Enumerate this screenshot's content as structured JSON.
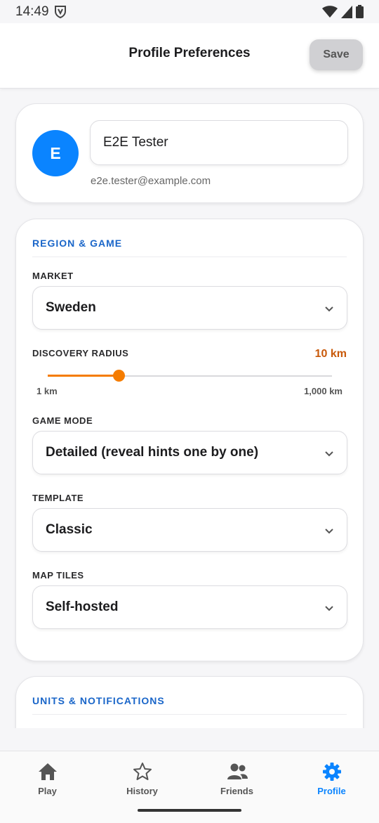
{
  "status_bar": {
    "time": "14:49",
    "icons": [
      "vpn-shield-icon",
      "wifi-icon",
      "cellular-signal-icon",
      "battery-icon"
    ]
  },
  "header": {
    "title": "Profile Preferences",
    "save_label": "Save"
  },
  "profile": {
    "avatar_initial": "E",
    "display_name": "E2E Tester",
    "email": "e2e.tester@example.com",
    "avatar_color": "#0a84ff"
  },
  "region_game": {
    "section_title": "REGION & GAME",
    "market": {
      "label": "MARKET",
      "value": "Sweden"
    },
    "discovery_radius": {
      "label": "DISCOVERY RADIUS",
      "value_text": "10 km",
      "min_label": "1 km",
      "max_label": "1,000 km",
      "slider_fraction": 0.25
    },
    "game_mode": {
      "label": "GAME MODE",
      "value": "Detailed (reveal hints one by one)"
    },
    "template": {
      "label": "TEMPLATE",
      "value": "Classic"
    },
    "map_tiles": {
      "label": "MAP TILES",
      "value": "Self-hosted"
    }
  },
  "units_notifications": {
    "section_title": "UNITS & NOTIFICATIONS"
  },
  "bottom_nav": {
    "items": [
      {
        "label": "Play",
        "icon": "home-icon",
        "active": false
      },
      {
        "label": "History",
        "icon": "star-icon",
        "active": false
      },
      {
        "label": "Friends",
        "icon": "people-icon",
        "active": false
      },
      {
        "label": "Profile",
        "icon": "gear-icon",
        "active": true
      }
    ]
  },
  "colors": {
    "accent": "#0a84ff",
    "section_title": "#1a66c9",
    "slider": "#f57c00",
    "radius_value": "#c8590a"
  }
}
